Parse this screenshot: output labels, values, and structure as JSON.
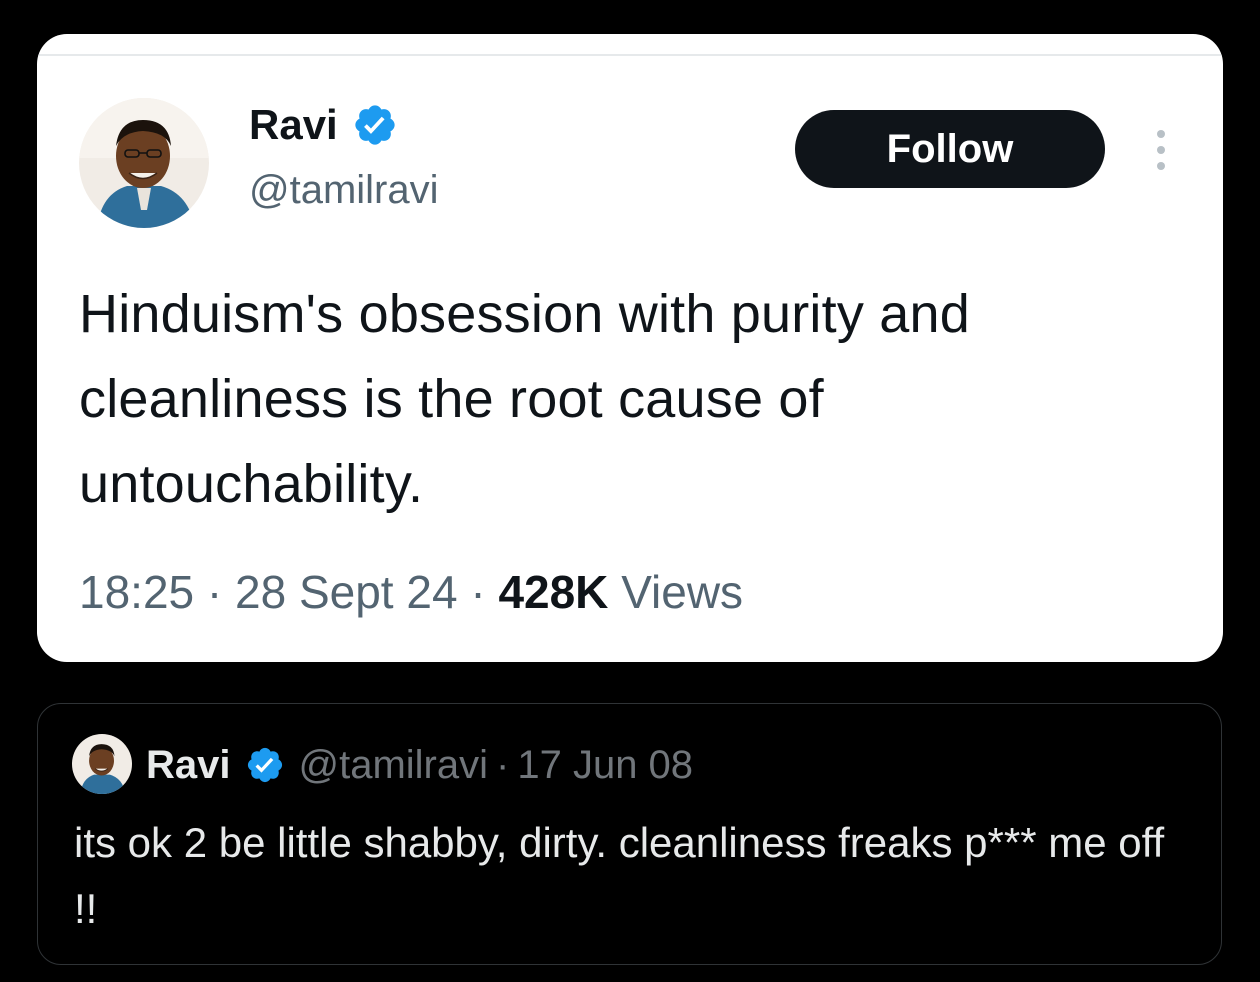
{
  "tweet": {
    "author_name": "Ravi",
    "handle": "@tamilravi",
    "follow_label": "Follow",
    "text": "Hinduism's obsession with purity and cleanliness is the root cause of untouchability.",
    "time": "18:25",
    "date": "28 Sept 24",
    "separator": "·",
    "views_count": "428K",
    "views_label": "Views",
    "verified_badge_icon": "verified-badge-icon",
    "more_icon": "more-vertical-icon",
    "colors": {
      "background": "#ffffff",
      "text": "#0f1419",
      "secondary_text": "#536471",
      "button": "#0f1419",
      "badge": "#1d9bf0"
    }
  },
  "quote": {
    "author_name": "Ravi",
    "handle": "@tamilravi",
    "separator": "·",
    "date": "17 Jun 08",
    "text": "its ok 2 be little shabby, dirty. cleanliness freaks p*** me off !!",
    "verified_badge_icon": "verified-badge-icon",
    "colors": {
      "background": "#000000",
      "text": "#e7e9ea",
      "secondary_text": "#71767b",
      "border": "#2f3336"
    }
  }
}
